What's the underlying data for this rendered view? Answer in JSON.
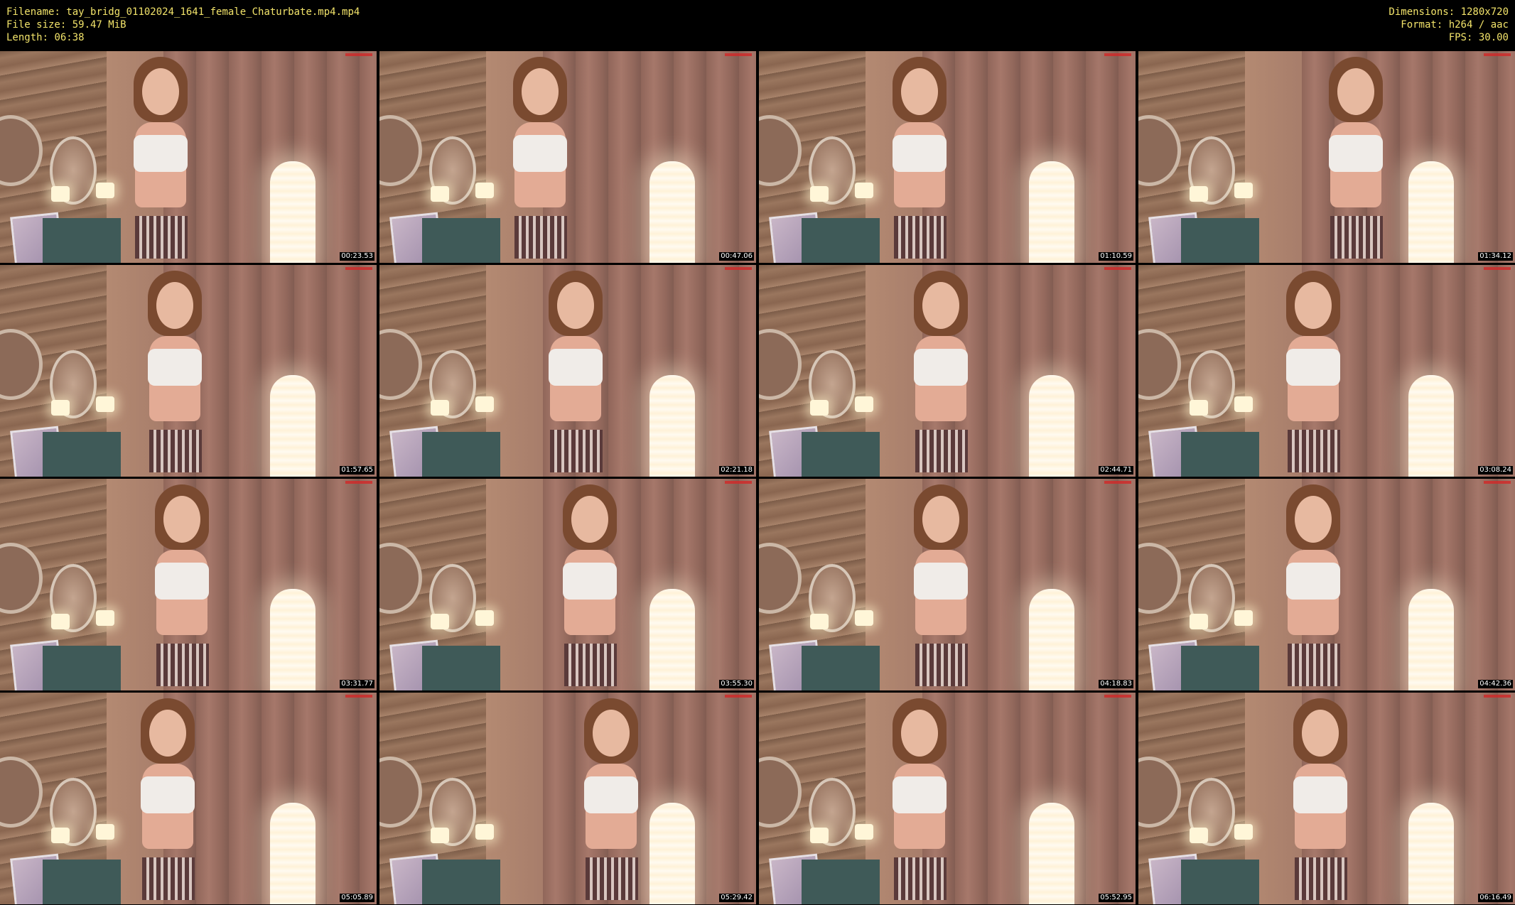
{
  "header": {
    "left": [
      {
        "label": "Filename",
        "value": "tay_bridg_01102024_1641_female_Chaturbate.mp4.mp4"
      },
      {
        "label": "File size",
        "value": "59.47 MiB"
      },
      {
        "label": "Length",
        "value": "06:38"
      }
    ],
    "right": [
      {
        "label": "Dimensions",
        "value": "1280x720"
      },
      {
        "label": "Format",
        "value": "h264 / aac"
      },
      {
        "label": "FPS",
        "value": "30.00"
      }
    ],
    "text_color": "#f2e36a",
    "background": "#000000"
  },
  "thumbnails": [
    {
      "timestamp": "00:23.53"
    },
    {
      "timestamp": "00:47.06"
    },
    {
      "timestamp": "01:10.59"
    },
    {
      "timestamp": "01:34.12"
    },
    {
      "timestamp": "01:57.65"
    },
    {
      "timestamp": "02:21.18"
    },
    {
      "timestamp": "02:44.71"
    },
    {
      "timestamp": "03:08.24"
    },
    {
      "timestamp": "03:31.77"
    },
    {
      "timestamp": "03:55.30"
    },
    {
      "timestamp": "04:18.83"
    },
    {
      "timestamp": "04:42.36"
    },
    {
      "timestamp": "05:05.89"
    },
    {
      "timestamp": "05:29.42"
    },
    {
      "timestamp": "05:52.95"
    },
    {
      "timestamp": "06:16.49"
    }
  ]
}
